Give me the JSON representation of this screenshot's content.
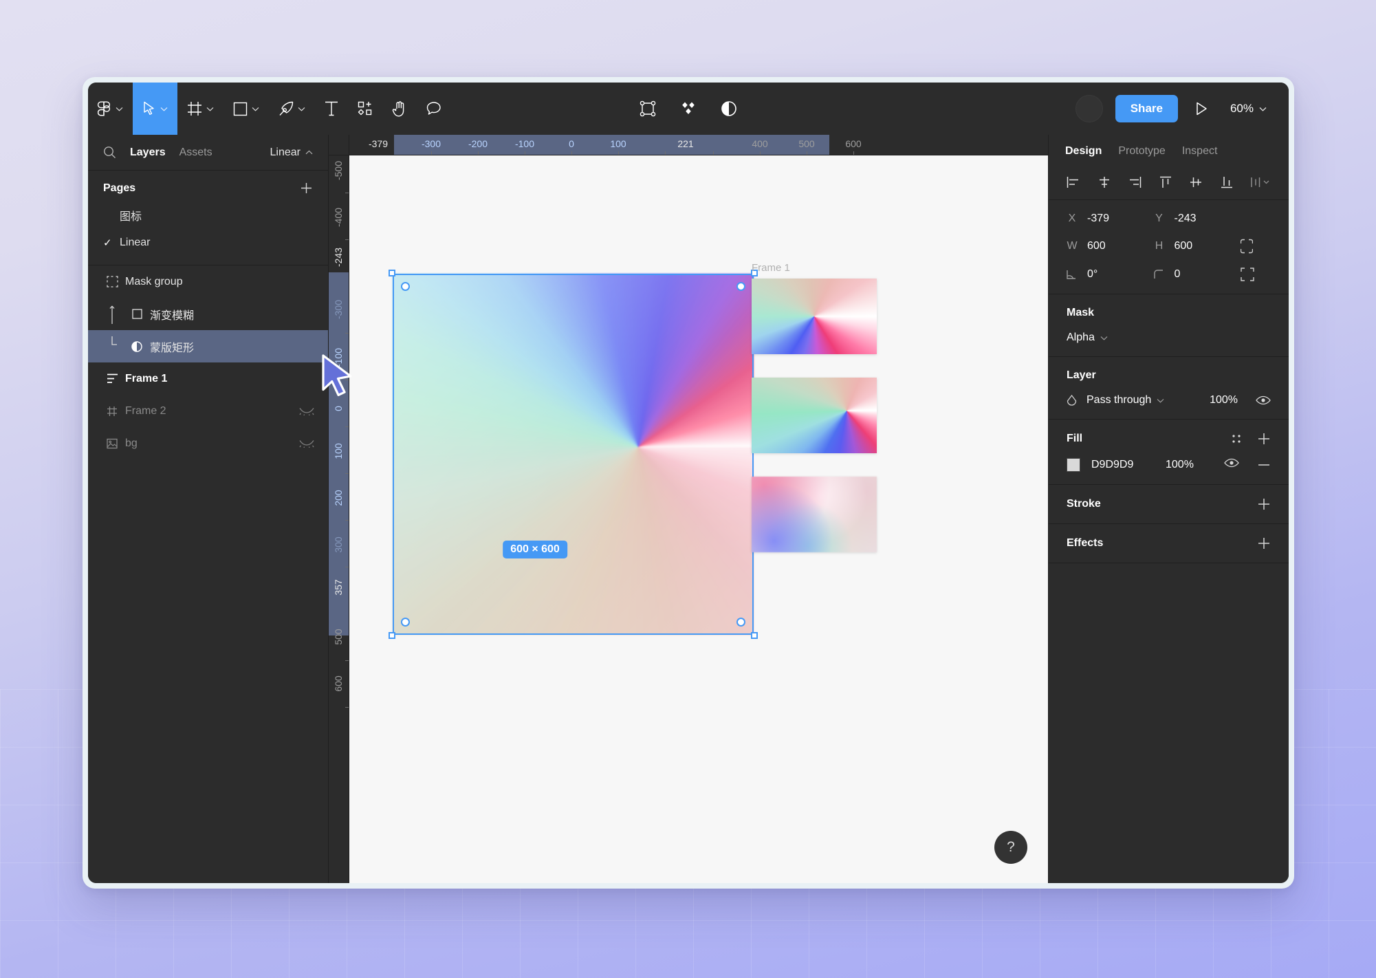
{
  "app": {
    "name": "Figma",
    "zoom_level": "60%"
  },
  "toolbar": {
    "menu_icon": "figma-logo-icon",
    "tools": [
      {
        "name": "move-tool",
        "icon": "cursor-arrow-icon",
        "active": true,
        "has_caret": true
      },
      {
        "name": "frame-tool",
        "icon": "frame-icon",
        "active": false,
        "has_caret": true
      },
      {
        "name": "shape-tool",
        "icon": "rectangle-icon",
        "active": false,
        "has_caret": true
      },
      {
        "name": "pen-tool",
        "icon": "pen-icon",
        "active": false,
        "has_caret": true
      },
      {
        "name": "text-tool",
        "icon": "text-t-icon",
        "active": false,
        "has_caret": false
      },
      {
        "name": "resources-tool",
        "icon": "components-plus-icon",
        "active": false,
        "has_caret": false
      },
      {
        "name": "hand-tool",
        "icon": "hand-icon",
        "active": false,
        "has_caret": false
      },
      {
        "name": "comment-tool",
        "icon": "comment-bubble-icon",
        "active": false,
        "has_caret": false
      }
    ],
    "center_tools": [
      {
        "name": "vector-edit-icon"
      },
      {
        "name": "plugins-diamond-icon"
      },
      {
        "name": "contrast-half-circle-icon"
      }
    ],
    "share_label": "Share",
    "present_icon": "play-triangle-icon",
    "zoom_label": "60%"
  },
  "left_panel": {
    "search_icon": "search-icon",
    "tabs": [
      {
        "label": "Layers",
        "active": true
      },
      {
        "label": "Assets",
        "active": false
      }
    ],
    "file_name": "Linear",
    "pages_header": "Pages",
    "add_page_icon": "plus-icon",
    "pages": [
      {
        "label": "图标",
        "selected": false
      },
      {
        "label": "Linear",
        "selected": true
      }
    ],
    "layers": [
      {
        "label": "Mask group",
        "icon": "mask-group-icon",
        "selected": false,
        "bold": false,
        "dim": false,
        "hidden": false,
        "indent": 0
      },
      {
        "label": "渐变模糊",
        "icon": "rectangle-outline-icon",
        "selected": false,
        "bold": false,
        "dim": false,
        "hidden": false,
        "indent": 1
      },
      {
        "label": "蒙版矩形",
        "icon": "mask-half-circle-icon",
        "selected": true,
        "bold": false,
        "dim": false,
        "hidden": false,
        "indent": 1
      },
      {
        "label": "Frame 1",
        "icon": "autolayout-icon",
        "selected": false,
        "bold": true,
        "dim": false,
        "hidden": false,
        "indent": 0
      },
      {
        "label": "Frame 2",
        "icon": "frame-hash-icon",
        "selected": false,
        "bold": false,
        "dim": true,
        "hidden": true,
        "indent": 0
      },
      {
        "label": "bg",
        "icon": "image-icon",
        "selected": false,
        "bold": false,
        "dim": true,
        "hidden": true,
        "indent": 0
      }
    ]
  },
  "rulers": {
    "horizontal": {
      "labels": [
        "-379",
        "-300",
        "-200",
        "-100",
        "0",
        "100",
        "221",
        "400",
        "500",
        "600"
      ],
      "start_label": "-379",
      "end_label": "221",
      "selection_start": "-379",
      "selection_end": "221"
    },
    "vertical": {
      "labels": [
        "-500",
        "-400",
        "-243",
        "-300",
        "-100",
        "0",
        "100",
        "200",
        "300",
        "357",
        "500",
        "600"
      ],
      "start_label": "-243",
      "end_label": "357"
    }
  },
  "canvas": {
    "selection_size_badge": "600 × 600",
    "frame_label": "Frame 1",
    "cursor_icon": "mouse-pointer-icon",
    "help_label": "?",
    "selection_color": "#4599F5"
  },
  "right_panel": {
    "tabs": [
      {
        "label": "Design",
        "active": true
      },
      {
        "label": "Prototype",
        "active": false
      },
      {
        "label": "Inspect",
        "active": false
      }
    ],
    "align_tools": [
      "align-left-icon",
      "align-horizontal-center-icon",
      "align-right-icon",
      "align-top-icon",
      "align-vertical-center-icon",
      "align-bottom-icon",
      "distribute-icon"
    ],
    "properties": {
      "x_label": "X",
      "x_value": "-379",
      "y_label": "Y",
      "y_value": "-243",
      "w_label": "W",
      "w_value": "600",
      "h_label": "H",
      "h_value": "600",
      "rotation_label": "rotation",
      "rotation_value": "0°",
      "corner_label": "corner-radius",
      "corner_value": "0",
      "constrain_icon": "link-constrain-icon",
      "independent_corners_icon": "independent-corners-icon"
    },
    "mask": {
      "title": "Mask",
      "type": "Alpha"
    },
    "layer": {
      "title": "Layer",
      "blend_mode": "Pass through",
      "opacity": "100%",
      "blend_icon": "blend-mode-icon",
      "visibility_icon": "eye-icon"
    },
    "fill": {
      "title": "Fill",
      "style_icon": "style-grid-icon",
      "add_icon": "plus-icon",
      "items": [
        {
          "hex": "D9D9D9",
          "opacity": "100%",
          "swatch_color": "#D9D9D9",
          "visibility_icon": "eye-icon",
          "remove_icon": "minus-icon"
        }
      ]
    },
    "stroke": {
      "title": "Stroke",
      "add_icon": "plus-icon"
    },
    "effects": {
      "title": "Effects",
      "add_icon": "plus-icon"
    }
  }
}
